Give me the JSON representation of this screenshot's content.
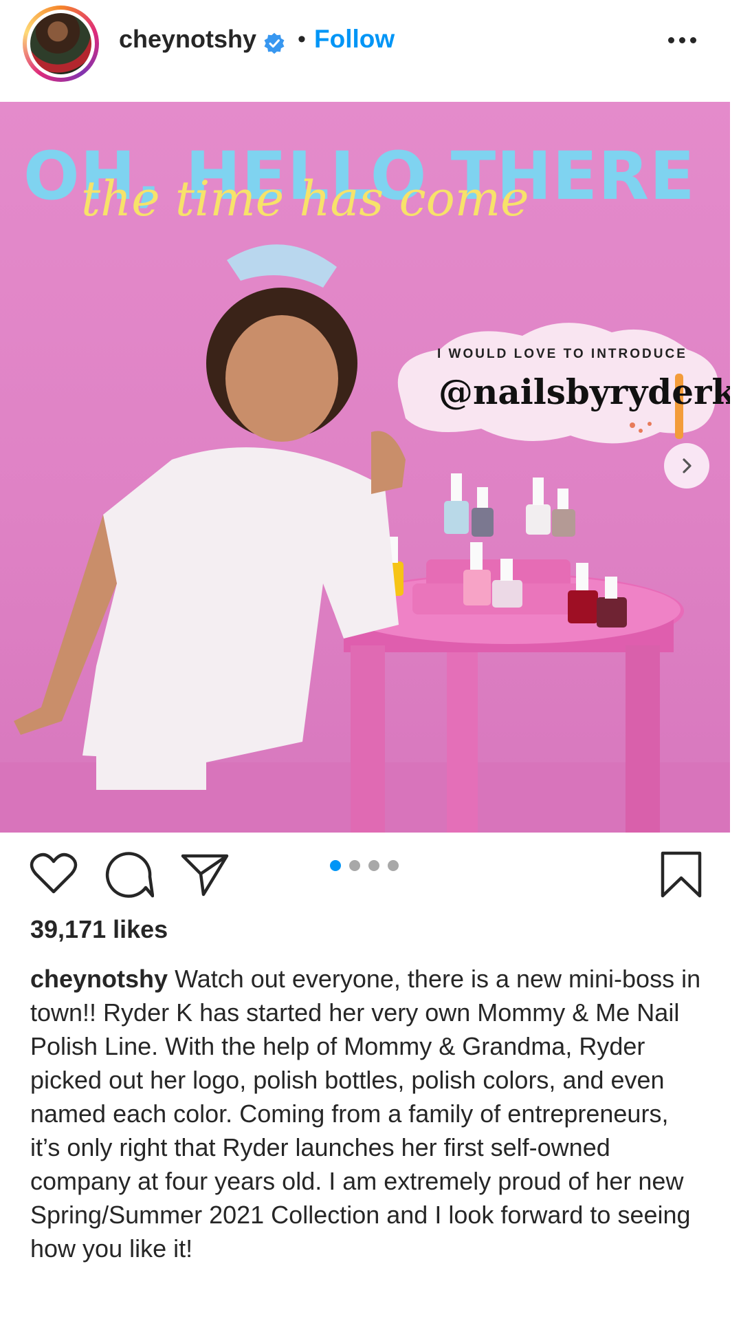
{
  "header": {
    "username": "cheynotshy",
    "separator": "•",
    "follow_label": "Follow"
  },
  "post": {
    "headline": "OH, HELLO THERE",
    "script_text": "the time has come",
    "intro_text": "I WOULD LOVE TO INTRODUCE",
    "handle_text": "@nailsbyryderk"
  },
  "carousel": {
    "total": 4,
    "active": 1
  },
  "likes": "39,171 likes",
  "caption": {
    "username": "cheynotshy",
    "text": "Watch out everyone, there is a new mini-boss in town!! Ryder K has started her very own Mommy & Me Nail Polish Line. With the help of Mommy & Grandma, Ryder picked out her logo, polish bottles, polish colors, and even named each color. Coming from a family of entrepreneurs, it’s only right that Ryder launches her first self-owned company at four years old. I am extremely proud of her new Spring/Summer 2021 Collection and I look forward to seeing how you like it!"
  },
  "colors": {
    "accent": "#0095f6",
    "verified": "#3897f0",
    "background_pink": "#df82c5"
  },
  "icons": [
    "verified-badge-icon",
    "more-options-icon",
    "chevron-right-icon",
    "heart-icon",
    "comment-icon",
    "share-icon",
    "bookmark-icon"
  ]
}
